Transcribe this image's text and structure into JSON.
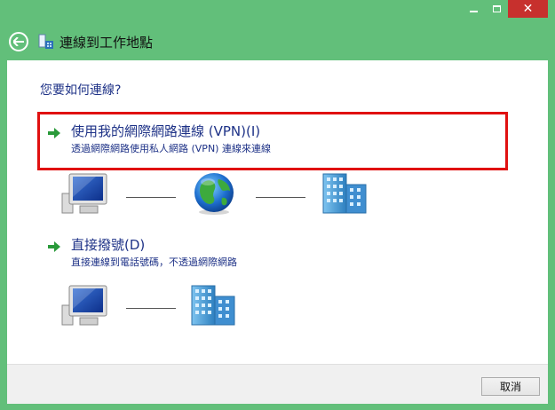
{
  "window": {
    "title": "連線到工作地點",
    "minimize_glyph": "–",
    "maximize_glyph": "□",
    "close_glyph": "✕"
  },
  "main": {
    "question": "您要如何連線?",
    "options": [
      {
        "title": "使用我的網際網路連線 (VPN)(I)",
        "description": "透過網際網路使用私人網路 (VPN) 連線來連線",
        "highlighted": true,
        "diagram": [
          "computer-icon",
          "internet-globe-icon",
          "workplace-building-icon"
        ]
      },
      {
        "title": "直接撥號(D)",
        "description": "直接連線到電話號碼，不透過網際網路",
        "highlighted": false,
        "diagram": [
          "computer-icon",
          "workplace-building-icon"
        ]
      }
    ]
  },
  "footer": {
    "cancel_label": "取消"
  },
  "colors": {
    "chrome": "#62bf7a",
    "close_button": "#c7302d",
    "link_text": "#1e3287",
    "highlight_border": "#e01010",
    "option_arrow": "#2a9a3a"
  }
}
